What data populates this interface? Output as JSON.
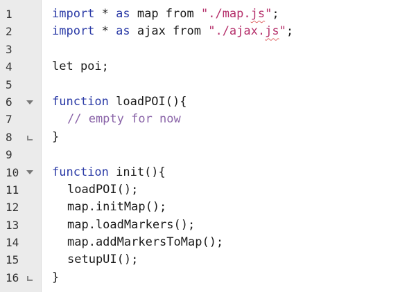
{
  "gutter": {
    "line_numbers": [
      "1",
      "2",
      "3",
      "4",
      "5",
      "6",
      "7",
      "8",
      "9",
      "10",
      "11",
      "12",
      "13",
      "14",
      "15",
      "16"
    ]
  },
  "code": {
    "line1": {
      "kw1": "import",
      "t1": " * ",
      "kw2": "as",
      "t2": " map from ",
      "str_open": "\"./map.",
      "str_ext": "js",
      "str_close": "\"",
      "t3": ";"
    },
    "line2": {
      "kw1": "import",
      "t1": " * ",
      "kw2": "as",
      "t2": " ajax from ",
      "str_open": "\"./ajax.",
      "str_ext": "js",
      "str_close": "\"",
      "t3": ";"
    },
    "line4": "let poi;",
    "line6": {
      "kw": "function",
      "rest": " loadPOI(){"
    },
    "line7": "// empty for now",
    "line8": "}",
    "line10": {
      "kw": "function",
      "rest": " init(){"
    },
    "line11": "loadPOI();",
    "line12": "map.initMap();",
    "line13": "map.loadMarkers();",
    "line14": "map.addMarkersToMap();",
    "line15": "setupUI();",
    "line16": "}"
  },
  "colors": {
    "keyword": "#2a3aa6",
    "string": "#b5306b",
    "comment": "#8a64a8",
    "error_underline": "#e06a6a",
    "gutter_bg": "#ebebeb"
  }
}
